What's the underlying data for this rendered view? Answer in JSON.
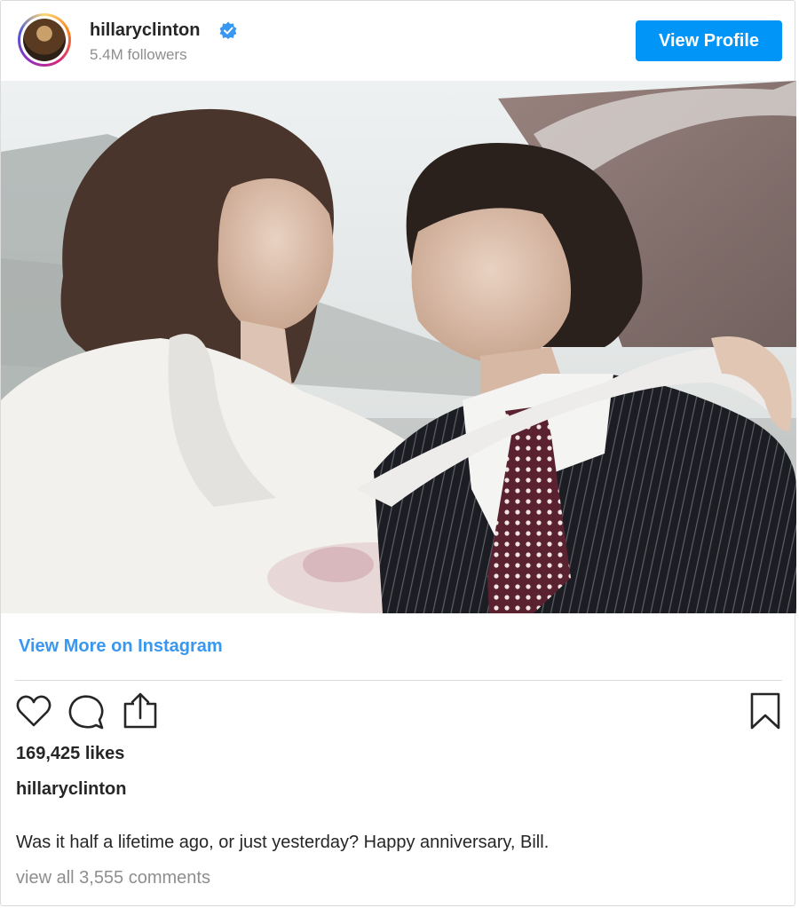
{
  "header": {
    "username": "hillaryclinton",
    "followers": "5.4M followers",
    "view_profile_label": "View Profile"
  },
  "post": {
    "view_more_label": "View More on Instagram",
    "likes": "169,425 likes",
    "caption_user": "hillaryclinton",
    "caption_text": "Was it half a lifetime ago, or just yesterday? Happy anniversary, Bill.",
    "comments_link": "view all 3,555 comments"
  },
  "icons": {
    "verified": "verified-badge-icon",
    "like": "heart-icon",
    "comment": "comment-bubble-icon",
    "share": "share-icon",
    "save": "bookmark-icon"
  },
  "colors": {
    "accent": "#0095f6",
    "link": "#3897f0",
    "secondary_text": "#8e8e8e"
  }
}
